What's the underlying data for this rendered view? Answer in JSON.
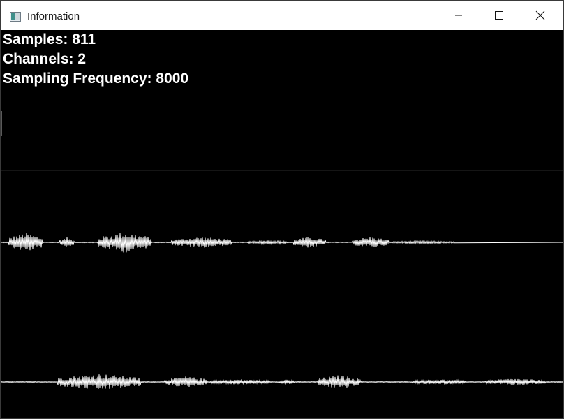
{
  "window": {
    "title": "Information",
    "icon": "app-window-icon",
    "controls": {
      "minimize_icon": "minimize-icon",
      "maximize_icon": "maximize-icon",
      "close_icon": "close-icon"
    }
  },
  "info": {
    "samples": "Samples: 811",
    "channels": "Channels: 2",
    "sampling_frequency": "Sampling Frequency: 8000"
  },
  "colors": {
    "background": "#000000",
    "waveform": "#ffffff",
    "divider": "#2a2a2a",
    "titlebar": "#ffffff"
  }
}
